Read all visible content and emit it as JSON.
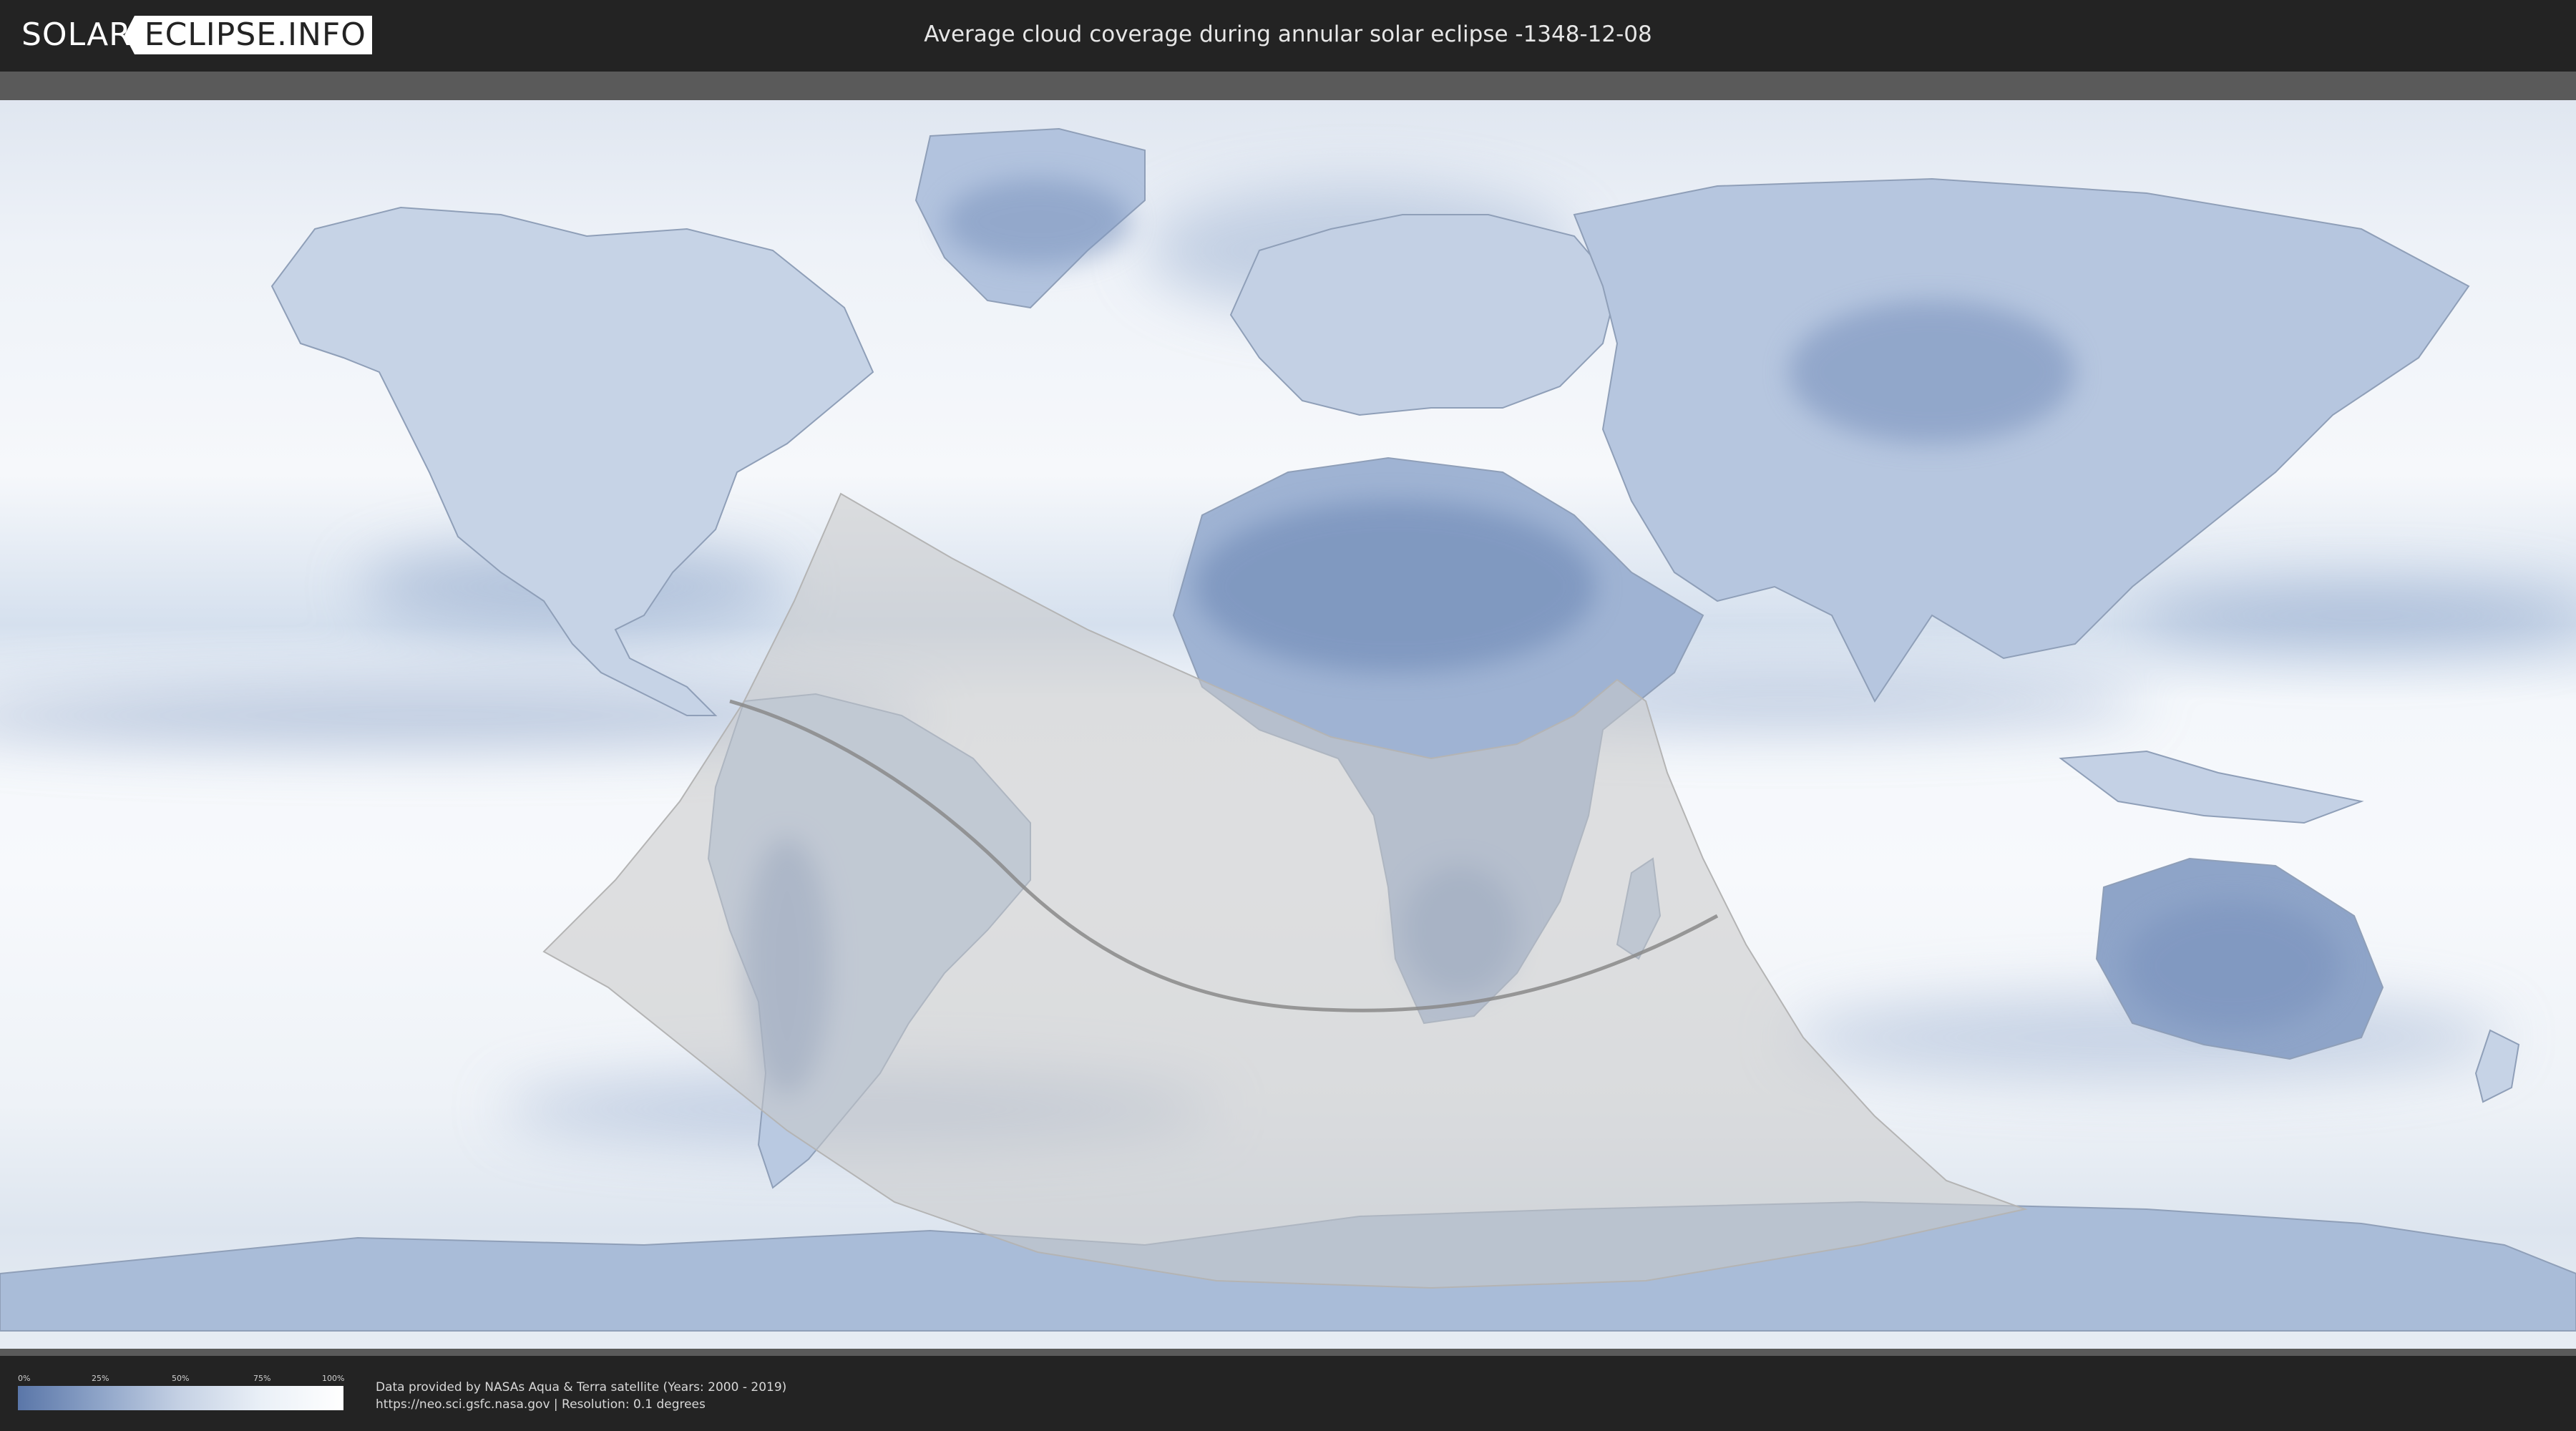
{
  "header": {
    "logo_left": "SOLAR",
    "logo_right": "ECLIPSE.INFO",
    "title": "Average cloud coverage during annular solar eclipse -1348-12-08"
  },
  "map": {
    "ocean_color": "#f2f5f9",
    "cloud_dark_color": "#6d88b5",
    "land_outline_color": "#8f9fb8",
    "eclipse_zone_fill": "#c8c8c8",
    "central_line_color": "#8a8a8a"
  },
  "legend": {
    "ticks": [
      "0%",
      "25%",
      "50%",
      "75%",
      "100%"
    ],
    "colors": [
      "#5a76a8",
      "#ffffff"
    ]
  },
  "credits": {
    "line1": "Data provided by NASAs Aqua & Terra satellite (Years: 2000 - 2019)",
    "line2": "https://neo.sci.gsfc.nasa.gov | Resolution: 0.1 degrees"
  }
}
